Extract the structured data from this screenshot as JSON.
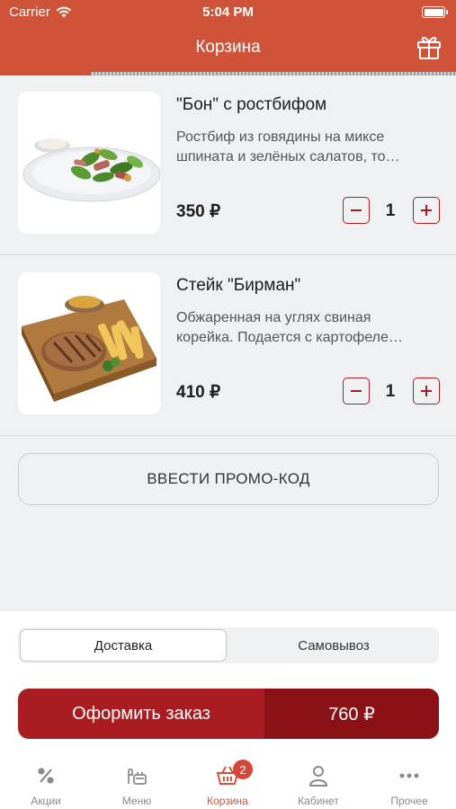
{
  "status_bar": {
    "carrier": "Carrier",
    "time": "5:04 PM"
  },
  "header": {
    "title": "Корзина",
    "gift_icon": "gift-icon",
    "progress": 0.2
  },
  "items": [
    {
      "name": "\"Бон\" с ростбифом",
      "description_line1": "Ростбиф из говядины на миксе",
      "description_line2": "шпината и зелёных салатов, то…",
      "price": "350 ₽",
      "quantity": "1",
      "image": "salad-photo"
    },
    {
      "name": "Стейк \"Бирман\"",
      "description_line1": "Обжаренная на углях свиная",
      "description_line2": "корейка. Подается с картофеле…",
      "price": "410 ₽",
      "quantity": "1",
      "image": "steak-photo"
    }
  ],
  "promo": {
    "label": "ВВЕСТИ ПРОМО-КОД"
  },
  "delivery": {
    "options": [
      "Доставка",
      "Самовывоз"
    ],
    "selected": "Доставка"
  },
  "order": {
    "label": "Оформить заказ",
    "total": "760 ₽"
  },
  "tabbar": {
    "tabs": [
      {
        "label": "Акции",
        "icon": "percent-icon"
      },
      {
        "label": "Меню",
        "icon": "menu-dish-icon"
      },
      {
        "label": "Корзина",
        "icon": "basket-icon",
        "badge": "2",
        "active": true
      },
      {
        "label": "Кабинет",
        "icon": "user-icon"
      },
      {
        "label": "Прочее",
        "icon": "more-icon"
      }
    ]
  },
  "colors": {
    "brand": "#cf5338",
    "accent": "#a81c22",
    "accent_dark": "#8a1116"
  }
}
